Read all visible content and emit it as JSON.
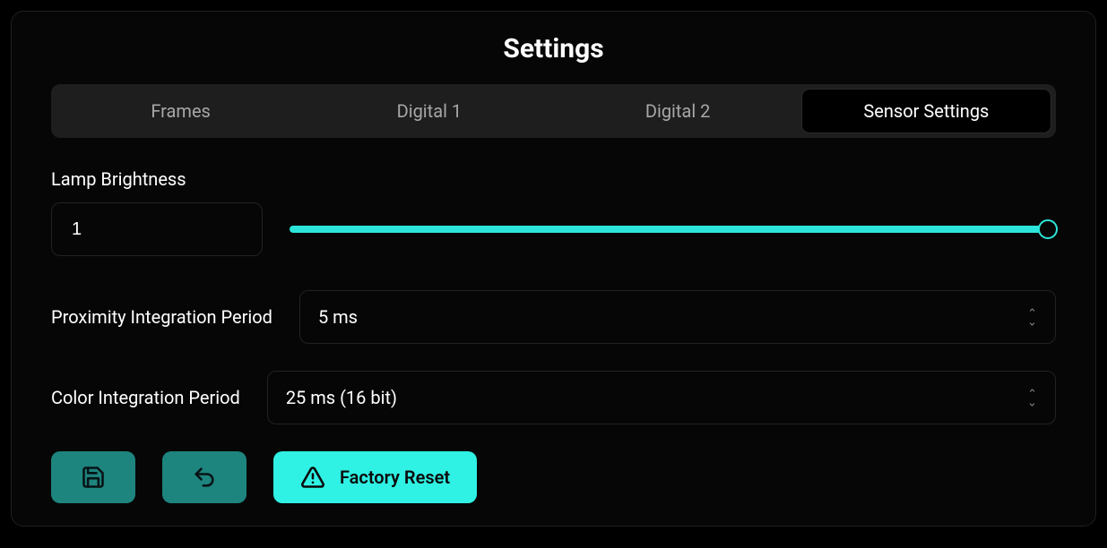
{
  "title": "Settings",
  "tabs": {
    "frames": "Frames",
    "digital1": "Digital 1",
    "digital2": "Digital 2",
    "sensor": "Sensor Settings"
  },
  "active_tab": "sensor",
  "brightness": {
    "label": "Lamp Brightness",
    "value": "1",
    "slider_percent": 100
  },
  "proximity": {
    "label": "Proximity Integration Period",
    "value": "5 ms"
  },
  "color_period": {
    "label": "Color Integration Period",
    "value": "25 ms (16 bit)"
  },
  "buttons": {
    "factory_reset": "Factory Reset"
  },
  "colors": {
    "accent_bright": "#2ff1e4",
    "accent_dim": "#1e847e"
  }
}
